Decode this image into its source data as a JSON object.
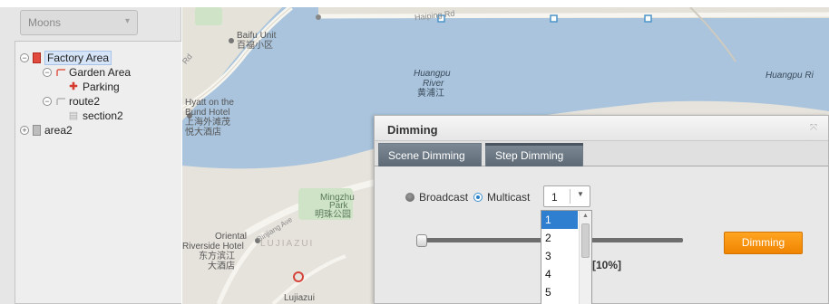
{
  "tree_panel": {
    "selector": {
      "value": "Moons"
    },
    "items": [
      {
        "label": "Factory Area",
        "toggle": "−",
        "icon": "red-building-icon"
      },
      {
        "label": "Garden Area",
        "toggle": "−",
        "icon": "route-icon"
      },
      {
        "label": "Parking",
        "icon": "red-lamp-icon"
      },
      {
        "label": "route2",
        "toggle": "−",
        "icon": "route-icon"
      },
      {
        "label": "section2",
        "icon": "grey-lamp-icon"
      },
      {
        "label": "area2",
        "toggle": "+",
        "icon": "grey-building-icon"
      }
    ]
  },
  "map": {
    "labels": {
      "baifu_en": "Baifu Unit",
      "baifu_cn": "百福小区",
      "huangpu_en_1": "Huangpu",
      "huangpu_en_2": "River",
      "huangpu_cn": "黄浦江",
      "huangpu_right": "Huangpu Ri",
      "hyatt_1": "Hyatt on the",
      "hyatt_2": "Bund Hotel",
      "hyatt_cn_1": "上海外滩茂",
      "hyatt_cn_2": "悦大酒店",
      "mingzhu_1": "Mingzhu",
      "mingzhu_2": "Park",
      "mingzhu_cn": "明珠公园",
      "oriental_1": "Oriental",
      "oriental_2": "Riverside Hotel",
      "oriental_cn_1": "东方滨江",
      "oriental_cn_2": "大酒店",
      "lujiazui_cn": "LUJIAZUI",
      "lujiazui": "Lujiazui",
      "haiping": "Haiping Rd",
      "binjiang": "Binjiang Ave",
      "rd": "Rd"
    }
  },
  "dialog": {
    "title": "Dimming",
    "close_icon": "close-icon",
    "tabs": [
      {
        "label": "Scene Dimming",
        "active": false
      },
      {
        "label": "Step Dimming",
        "active": true
      }
    ],
    "radio": {
      "broadcast_label": "Broadcast",
      "multicast_label": "Multicast",
      "selected": "Multicast"
    },
    "group_select": {
      "value": "1",
      "options": [
        "1",
        "2",
        "3",
        "4",
        "5"
      ]
    },
    "slider": {
      "value_text": "[10%]",
      "value_fraction": 0.1
    },
    "dimming_button": "Dimming"
  },
  "colors": {
    "accent_button": "#f08400",
    "tab_bg": "#5d6974",
    "selected_option": "#2f7fd0",
    "river": "#a9c4dc"
  }
}
